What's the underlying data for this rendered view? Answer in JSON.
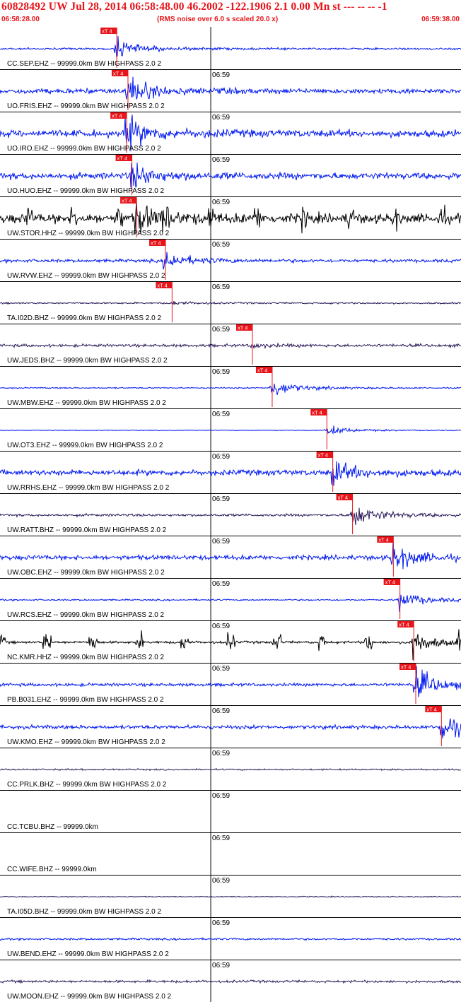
{
  "header": {
    "title": "60828492 UW Jul 28, 2014 06:58:48.00   46.2002 -122.1906  2.1 0.00 Mn st --- -- --  -1",
    "start_time": "06:58:28.00",
    "noise_note": "(RMS noise over 6.0 s scaled 20.0 x)",
    "end_time": "06:59:38.00"
  },
  "chart_data": {
    "type": "seismogram",
    "time_start": "06:58:28.00",
    "time_end": "06:59:38.00",
    "minute_mark": {
      "label": "06:59",
      "seconds_from_start": 32
    },
    "pick_label": "xT 4",
    "colors": {
      "blue": "#0018f0",
      "black": "#000000",
      "purple": "#2b1a5a",
      "pick": "#e8141a"
    },
    "traces": [
      {
        "label": "CC.SEP.EHZ -- 99999.0km BW  HIGHPASS  2.0  2",
        "color": "blue",
        "pick_s": 17.3,
        "noise": 0.06,
        "event_amp": 0.62
      },
      {
        "label": "UO.FRIS.EHZ -- 99999.0km BW  HIGHPASS  2.0  2",
        "color": "blue",
        "pick_s": 19.0,
        "noise": 0.16,
        "event_amp": 0.95
      },
      {
        "label": "UO.IRO.EHZ -- 99999.0km BW  HIGHPASS  2.0  2",
        "color": "blue",
        "pick_s": 18.8,
        "noise": 0.22,
        "event_amp": 1.0
      },
      {
        "label": "UO.HUO.EHZ -- 99999.0km BW  HIGHPASS  2.0  2",
        "color": "blue",
        "pick_s": 19.6,
        "noise": 0.2,
        "event_amp": 0.8
      },
      {
        "label": "UW.STOR.HHZ -- 99999.0km BW  HIGHPASS  2.0  2",
        "color": "black",
        "pick_s": 20.3,
        "noise": 0.3,
        "event_amp": 0.9
      },
      {
        "label": "UW.RVW.EHZ -- 99999.0km BW  HIGHPASS  2.0  2",
        "color": "blue",
        "pick_s": 24.7,
        "noise": 0.1,
        "event_amp": 0.6
      },
      {
        "label": "TA.I02D.BHZ -- 99999.0km BW  HIGHPASS  2.0  2",
        "color": "purple",
        "pick_s": 25.7,
        "noise": 0.05,
        "event_amp": 0.1
      },
      {
        "label": "UW.JEDS.BHZ -- 99999.0km BW  HIGHPASS  2.0  2",
        "color": "purple",
        "pick_s": 37.9,
        "noise": 0.09,
        "event_amp": 0.12
      },
      {
        "label": "UW.MBW.EHZ -- 99999.0km BW  HIGHPASS  2.0  2",
        "color": "blue",
        "pick_s": 40.9,
        "noise": 0.04,
        "event_amp": 0.6
      },
      {
        "label": "UW.OT3.EHZ -- 99999.0km BW  HIGHPASS  2.0  2",
        "color": "blue",
        "pick_s": 49.2,
        "noise": 0.02,
        "event_amp": 0.35
      },
      {
        "label": "UW.RRHS.EHZ -- 99999.0km BW  HIGHPASS  2.0  2",
        "color": "blue",
        "pick_s": 50.1,
        "noise": 0.18,
        "event_amp": 0.75
      },
      {
        "label": "UW.RATT.BHZ -- 99999.0km BW  HIGHPASS  2.0  2",
        "color": "purple",
        "pick_s": 53.1,
        "noise": 0.08,
        "event_amp": 0.8
      },
      {
        "label": "UW.OBC.EHZ -- 99999.0km BW  HIGHPASS  2.0  2",
        "color": "blue",
        "pick_s": 59.3,
        "noise": 0.15,
        "event_amp": 0.9
      },
      {
        "label": "UW.RCS.EHZ -- 99999.0km BW  HIGHPASS  2.0  2",
        "color": "blue",
        "pick_s": 60.3,
        "noise": 0.05,
        "event_amp": 0.6
      },
      {
        "label": "NC.KMR.HHZ -- 99999.0km BW  HIGHPASS  2.0  2",
        "color": "black",
        "pick_s": 62.4,
        "noise": 0.08,
        "event_amp": 0.7
      },
      {
        "label": "PB.B031.EHZ -- 99999.0km BW  HIGHPASS  2.0  2",
        "color": "blue",
        "pick_s": 62.7,
        "noise": 0.1,
        "event_amp": 1.0
      },
      {
        "label": "UW.KMO.EHZ -- 99999.0km BW  HIGHPASS  2.0  2",
        "color": "blue",
        "pick_s": 66.6,
        "noise": 0.12,
        "event_amp": 0.95
      },
      {
        "label": "CC.PRLK.BHZ -- 99999.0km BW  HIGHPASS  2.0  2",
        "color": "purple",
        "pick_s": null,
        "noise": 0.05,
        "event_amp": 0
      },
      {
        "label": "CC.TCBU.BHZ -- 99999.0km",
        "color": "black",
        "pick_s": null,
        "noise": 0,
        "event_amp": 0
      },
      {
        "label": "CC.WIFE.BHZ -- 99999.0km",
        "color": "black",
        "pick_s": null,
        "noise": 0,
        "event_amp": 0
      },
      {
        "label": "TA.I05D.BHZ -- 99999.0km BW  HIGHPASS  2.0  2",
        "color": "purple",
        "pick_s": null,
        "noise": 0.03,
        "event_amp": 0
      },
      {
        "label": "UW.BEND.EHZ -- 99999.0km BW  HIGHPASS  2.0  2",
        "color": "blue",
        "pick_s": null,
        "noise": 0.06,
        "event_amp": 0
      },
      {
        "label": "UW.MOON.EHZ -- 99999.0km BW  HIGHPASS  2.0  2",
        "color": "purple",
        "pick_s": null,
        "noise": 0.08,
        "event_amp": 0
      }
    ]
  }
}
